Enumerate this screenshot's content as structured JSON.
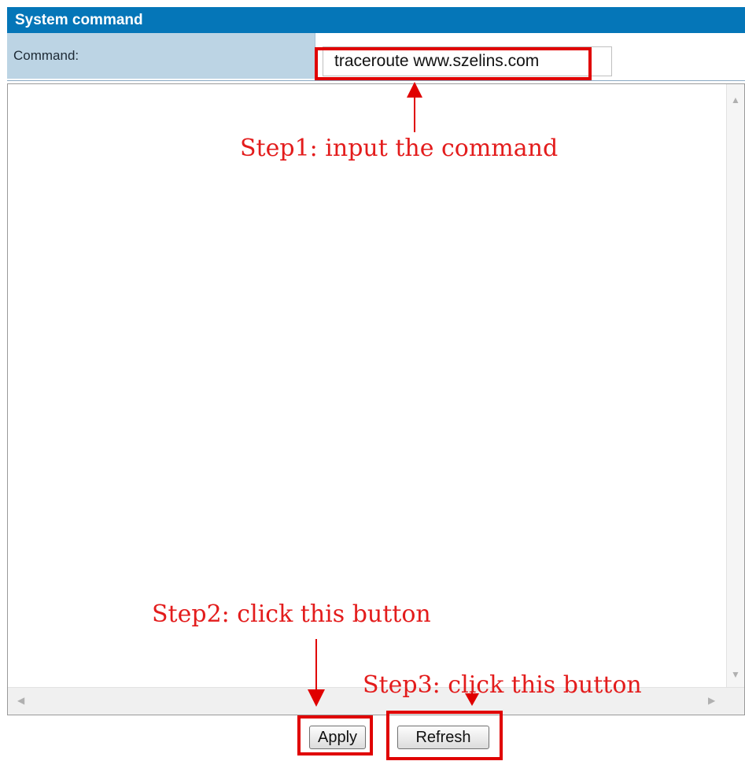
{
  "panel": {
    "title": "System command"
  },
  "command": {
    "label": "Command:",
    "value": "traceroute www.szelins.com"
  },
  "buttons": {
    "apply": "Apply",
    "refresh": "Refresh"
  },
  "annotations": {
    "step1": "Step1: input the command",
    "step2": "Step2: click this button",
    "step3": "Step3: click this button"
  },
  "colors": {
    "header": "#0576b8",
    "label_bg": "#bcd4e4",
    "annotation": "#e00000"
  }
}
